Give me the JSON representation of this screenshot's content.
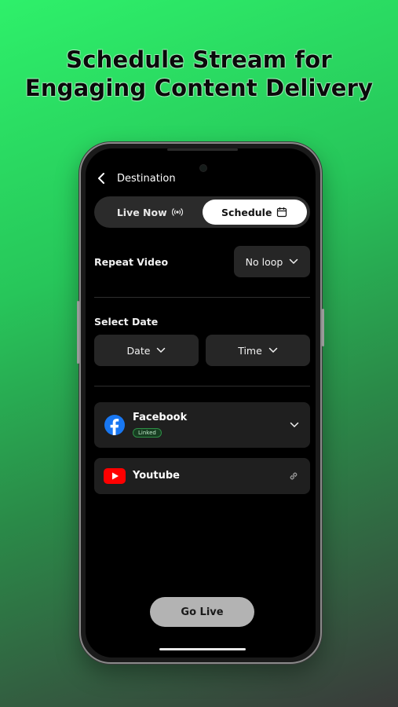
{
  "headline": {
    "line1": "Schedule Stream for",
    "line2": "Engaging Content Delivery"
  },
  "header": {
    "title": "Destination",
    "back_icon": "chevron-left-icon"
  },
  "mode_tabs": {
    "live_now": "Live Now",
    "schedule": "Schedule",
    "selected": "Schedule",
    "live_icon": "broadcast-icon",
    "schedule_icon": "calendar-icon"
  },
  "repeat": {
    "label": "Repeat Video",
    "value": "No loop"
  },
  "select_date": {
    "label": "Select Date",
    "date_value": "Date",
    "time_value": "Time"
  },
  "destinations": [
    {
      "name": "Facebook",
      "badge": "Linked",
      "icon": "facebook-icon",
      "action_icon": "chevron-down-icon",
      "brand_color": "#1877F2"
    },
    {
      "name": "Youtube",
      "icon": "youtube-icon",
      "action_icon": "link-icon",
      "brand_color": "#FF0000"
    }
  ],
  "cta": {
    "label": "Go Live"
  },
  "colors": {
    "accent_bg": "#2EF06A",
    "screen_bg": "#000000",
    "card_bg": "#1F1F1F",
    "linked_green": "#2E8F46"
  }
}
